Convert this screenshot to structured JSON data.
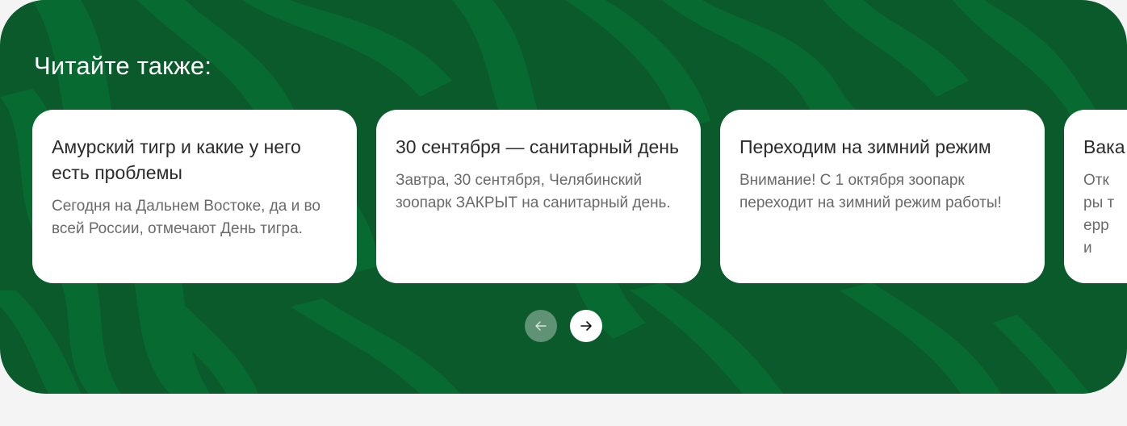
{
  "section": {
    "title": "Читайте также:",
    "colors": {
      "background": "#0b5a2c",
      "stripe": "#076a30",
      "card": "#ffffff"
    }
  },
  "cards": [
    {
      "title": "Амурский тигр и какие у него есть проблемы",
      "text": "Сегодня на Дальнем Востоке, да и во всей России, отмечают День тигра."
    },
    {
      "title": "30 сентября — санитарный день",
      "text": "Завтра, 30 сентября, Челябинский зоопарк ЗАКРЫТ на санитарный день."
    },
    {
      "title": "Переходим на зимний режим",
      "text": "Внимание! С 1 октября зоопарк переходит на зимний режим работы!"
    },
    {
      "title": "Вака",
      "text": "Откры терри"
    }
  ],
  "nav": {
    "prev_icon": "arrow-left-icon",
    "next_icon": "arrow-right-icon"
  }
}
